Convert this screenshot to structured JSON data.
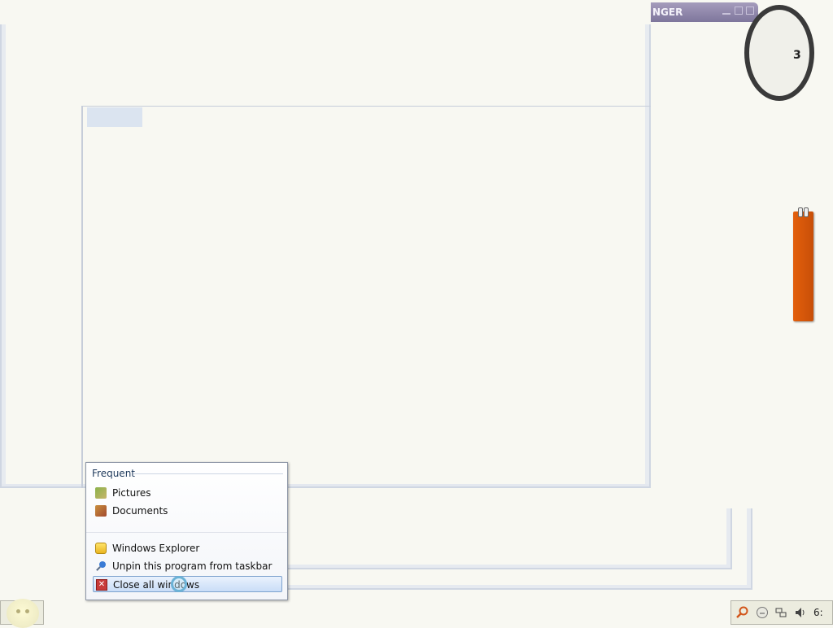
{
  "app_window": {
    "title_fragment": "NGER"
  },
  "clock_gadget": {
    "visible_numeral": "3"
  },
  "jump_list": {
    "section_header": "Frequent",
    "frequent_items": [
      {
        "label": "Pictures",
        "icon": "pictures-library-icon"
      },
      {
        "label": "Documents",
        "icon": "documents-library-icon"
      }
    ],
    "tasks": [
      {
        "label": "Windows Explorer",
        "icon": "windows-explorer-icon"
      },
      {
        "label": "Unpin this program from taskbar",
        "icon": "unpin-icon"
      },
      {
        "label": "Close all windows",
        "icon": "close-windows-icon",
        "highlighted": true
      }
    ]
  },
  "taskbar": {
    "tray_time_fragment": "6:"
  }
}
